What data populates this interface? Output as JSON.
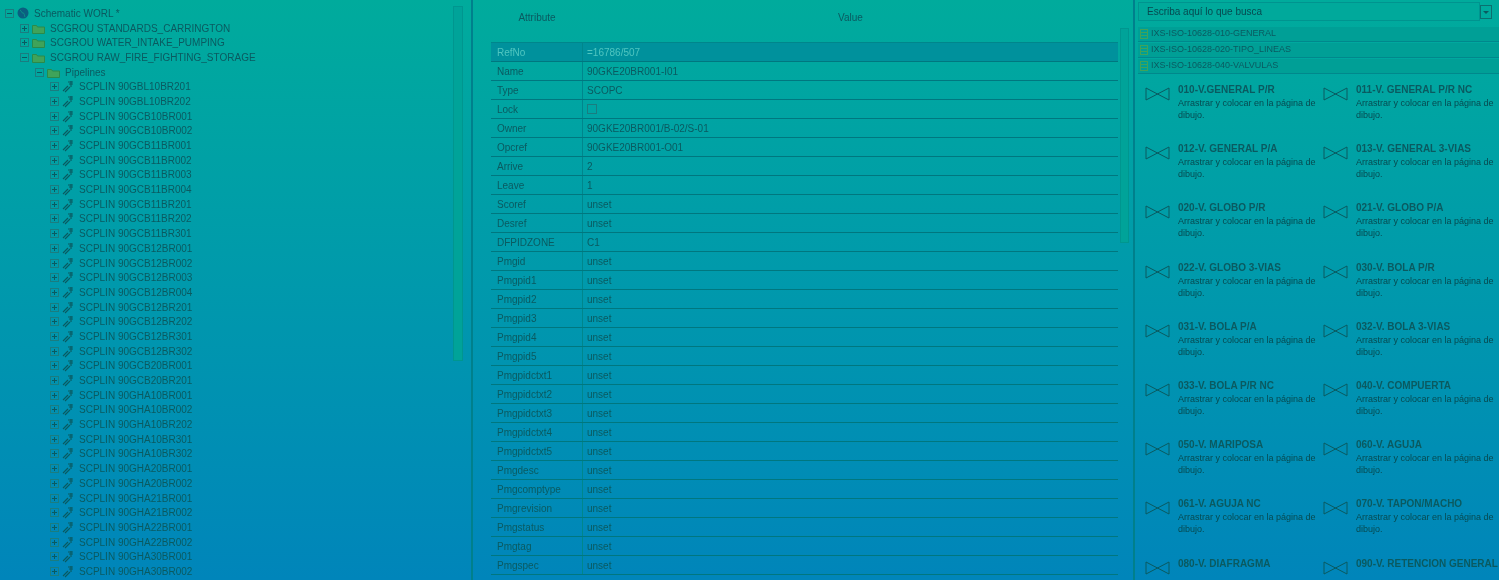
{
  "tree": {
    "label": "Schematic WORL *",
    "expanded": true,
    "children": [
      {
        "label": "SCGROU STANDARDS_CARRINGTON",
        "expanded": false
      },
      {
        "label": "SCGROU WATER_INTAKE_PUMPING",
        "expanded": false
      },
      {
        "label": "SCGROU RAW_FIRE_FIGHTING_STORAGE",
        "expanded": true,
        "children": [
          {
            "label": "Pipelines",
            "expanded": true,
            "children": [
              {
                "label": "SCPLIN 90GBL10BR201",
                "expanded": false
              },
              {
                "label": "SCPLIN 90GBL10BR202",
                "expanded": false
              },
              {
                "label": "SCPLIN 90GCB10BR001",
                "expanded": false
              },
              {
                "label": "SCPLIN 90GCB10BR002",
                "expanded": false
              },
              {
                "label": "SCPLIN 90GCB11BR001",
                "expanded": false
              },
              {
                "label": "SCPLIN 90GCB11BR002",
                "expanded": false
              },
              {
                "label": "SCPLIN 90GCB11BR003",
                "expanded": false
              },
              {
                "label": "SCPLIN 90GCB11BR004",
                "expanded": false
              },
              {
                "label": "SCPLIN 90GCB11BR201",
                "expanded": false
              },
              {
                "label": "SCPLIN 90GCB11BR202",
                "expanded": false
              },
              {
                "label": "SCPLIN 90GCB11BR301",
                "expanded": false
              },
              {
                "label": "SCPLIN 90GCB12BR001",
                "expanded": false
              },
              {
                "label": "SCPLIN 90GCB12BR002",
                "expanded": false
              },
              {
                "label": "SCPLIN 90GCB12BR003",
                "expanded": false
              },
              {
                "label": "SCPLIN 90GCB12BR004",
                "expanded": false
              },
              {
                "label": "SCPLIN 90GCB12BR201",
                "expanded": false
              },
              {
                "label": "SCPLIN 90GCB12BR202",
                "expanded": false
              },
              {
                "label": "SCPLIN 90GCB12BR301",
                "expanded": false
              },
              {
                "label": "SCPLIN 90GCB12BR302",
                "expanded": false
              },
              {
                "label": "SCPLIN 90GCB20BR001",
                "expanded": false
              },
              {
                "label": "SCPLIN 90GCB20BR201",
                "expanded": false
              },
              {
                "label": "SCPLIN 90GHA10BR001",
                "expanded": false
              },
              {
                "label": "SCPLIN 90GHA10BR002",
                "expanded": false
              },
              {
                "label": "SCPLIN 90GHA10BR202",
                "expanded": false
              },
              {
                "label": "SCPLIN 90GHA10BR301",
                "expanded": false
              },
              {
                "label": "SCPLIN 90GHA10BR302",
                "expanded": false
              },
              {
                "label": "SCPLIN 90GHA20BR001",
                "expanded": false
              },
              {
                "label": "SCPLIN 90GHA20BR002",
                "expanded": false
              },
              {
                "label": "SCPLIN 90GHA21BR001",
                "expanded": false
              },
              {
                "label": "SCPLIN 90GHA21BR002",
                "expanded": false
              },
              {
                "label": "SCPLIN 90GHA22BR001",
                "expanded": false
              },
              {
                "label": "SCPLIN 90GHA22BR002",
                "expanded": false
              },
              {
                "label": "SCPLIN 90GHA30BR001",
                "expanded": false
              },
              {
                "label": "SCPLIN 90GHA30BR002",
                "expanded": false
              }
            ]
          }
        ]
      }
    ]
  },
  "attributes": {
    "columns": [
      "Attribute",
      "Value"
    ],
    "rows": [
      {
        "kind": "text",
        "attribute": "RefNo",
        "value": "=16786/507",
        "selected": true
      },
      {
        "kind": "text",
        "attribute": "Name",
        "value": "90GKE20BR001-I01",
        "selected": false
      },
      {
        "kind": "text",
        "attribute": "Type",
        "value": "SCOPC",
        "selected": false
      },
      {
        "kind": "checkbox",
        "attribute": "Lock",
        "checked": false,
        "selected": false
      },
      {
        "kind": "text",
        "attribute": "Owner",
        "value": "90GKE20BR001/B-02/S-01",
        "selected": false
      },
      {
        "kind": "text",
        "attribute": "Opcref",
        "value": "90GKE20BR001-O01",
        "selected": false
      },
      {
        "kind": "text",
        "attribute": "Arrive",
        "value": "2",
        "selected": false
      },
      {
        "kind": "text",
        "attribute": "Leave",
        "value": "1",
        "selected": false
      },
      {
        "kind": "text",
        "attribute": "Scoref",
        "value": "unset",
        "selected": false
      },
      {
        "kind": "text",
        "attribute": "Desref",
        "value": "unset",
        "selected": false
      },
      {
        "kind": "text",
        "attribute": "DFPIDZONE",
        "value": "C1",
        "selected": false
      },
      {
        "kind": "text",
        "attribute": "Pmgid",
        "value": "unset",
        "selected": false
      },
      {
        "kind": "text",
        "attribute": "Pmgpid1",
        "value": "unset",
        "selected": false
      },
      {
        "kind": "text",
        "attribute": "Pmgpid2",
        "value": "unset",
        "selected": false
      },
      {
        "kind": "text",
        "attribute": "Pmgpid3",
        "value": "unset",
        "selected": false
      },
      {
        "kind": "text",
        "attribute": "Pmgpid4",
        "value": "unset",
        "selected": false
      },
      {
        "kind": "text",
        "attribute": "Pmgpid5",
        "value": "unset",
        "selected": false
      },
      {
        "kind": "text",
        "attribute": "Pmgpidctxt1",
        "value": "unset",
        "selected": false
      },
      {
        "kind": "text",
        "attribute": "Pmgpidctxt2",
        "value": "unset",
        "selected": false
      },
      {
        "kind": "text",
        "attribute": "Pmgpidctxt3",
        "value": "unset",
        "selected": false
      },
      {
        "kind": "text",
        "attribute": "Pmgpidctxt4",
        "value": "unset",
        "selected": false
      },
      {
        "kind": "text",
        "attribute": "Pmgpidctxt5",
        "value": "unset",
        "selected": false
      },
      {
        "kind": "text",
        "attribute": "Pmgdesc",
        "value": "unset",
        "selected": false
      },
      {
        "kind": "text",
        "attribute": "Pmgcomptype",
        "value": "unset",
        "selected": false
      },
      {
        "kind": "text",
        "attribute": "Pmgrevision",
        "value": "unset",
        "selected": false
      },
      {
        "kind": "text",
        "attribute": "Pmgstatus",
        "value": "unset",
        "selected": false
      },
      {
        "kind": "text",
        "attribute": "Pmgtag",
        "value": "unset",
        "selected": false
      },
      {
        "kind": "text",
        "attribute": "Pmgspec",
        "value": "unset",
        "selected": false
      }
    ]
  },
  "shapes_panel": {
    "search": {
      "placeholder": "Escriba aquí lo que busca"
    },
    "stencils": [
      "IXS-ISO-10628-010-GENERAL",
      "IXS-ISO-10628-020-TIPO_LINEAS",
      "IXS-ISO-10628-040-VALVULAS"
    ],
    "shapes": [
      {
        "title": "010-V.GENERAL P/R",
        "hint": "Arrastrar y colocar en la página de dibujo."
      },
      {
        "title": "011-V. GENERAL P/R NC",
        "hint": "Arrastrar y colocar en la página de dibujo."
      },
      {
        "title": "012-V. GENERAL P/A",
        "hint": "Arrastrar y colocar en la página de dibujo."
      },
      {
        "title": "013-V. GENERAL 3-VIAS",
        "hint": "Arrastrar y colocar en la página de dibujo."
      },
      {
        "title": "020-V. GLOBO P/R",
        "hint": "Arrastrar y colocar en la página de dibujo."
      },
      {
        "title": "021-V. GLOBO P/A",
        "hint": "Arrastrar y colocar en la página de dibujo."
      },
      {
        "title": "022-V. GLOBO 3-VIAS",
        "hint": "Arrastrar y colocar en la página de dibujo."
      },
      {
        "title": "030-V. BOLA P/R",
        "hint": "Arrastrar y colocar en la página de dibujo."
      },
      {
        "title": "031-V. BOLA P/A",
        "hint": "Arrastrar y colocar en la página de dibujo."
      },
      {
        "title": "032-V. BOLA 3-VIAS",
        "hint": "Arrastrar y colocar en la página de dibujo."
      },
      {
        "title": "033-V. BOLA P/R NC",
        "hint": "Arrastrar y colocar en la página de dibujo."
      },
      {
        "title": "040-V. COMPUERTA",
        "hint": "Arrastrar y colocar en la página de dibujo."
      },
      {
        "title": "050-V. MARIPOSA",
        "hint": "Arrastrar y colocar en la página de dibujo."
      },
      {
        "title": "060-V. AGUJA",
        "hint": "Arrastrar y colocar en la página de dibujo."
      },
      {
        "title": "061-V. AGUJA NC",
        "hint": "Arrastrar y colocar en la página de dibujo."
      },
      {
        "title": "070-V. TAPON/MACHO",
        "hint": "Arrastrar y colocar en la página de dibujo."
      },
      {
        "title": "080-V. DIAFRAGMA"
      },
      {
        "title": "090-V. RETENCION GENERAL"
      }
    ]
  }
}
